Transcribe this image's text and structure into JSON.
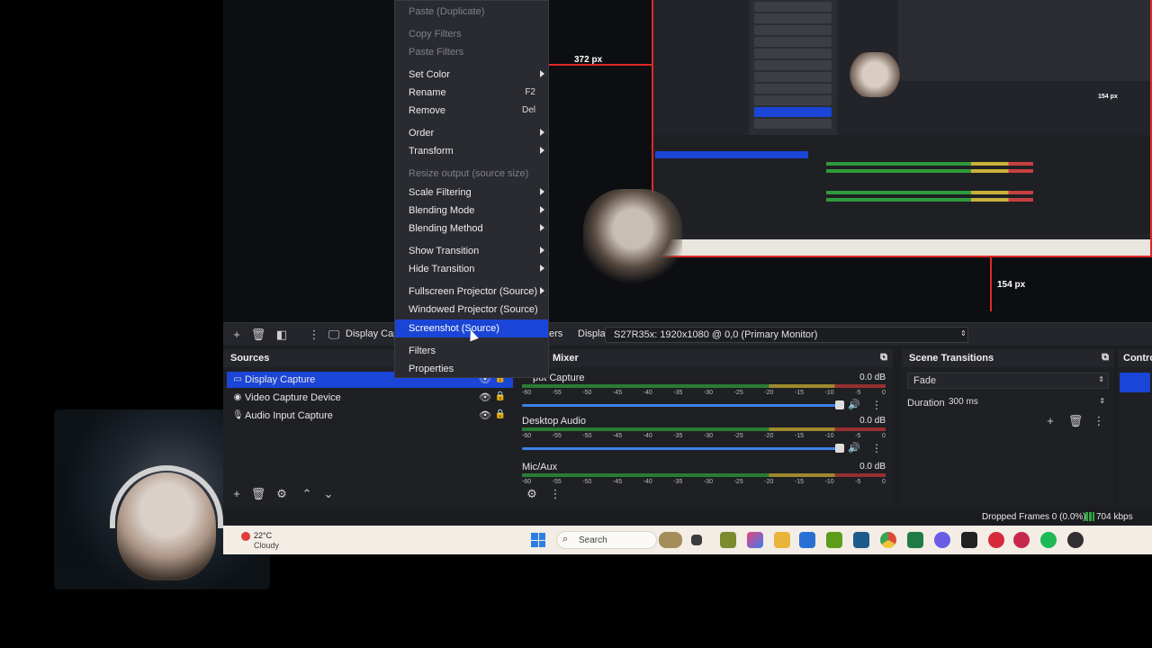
{
  "preview": {
    "width_label": "372 px",
    "height_label": "154 px",
    "mini_height_label": "154 px"
  },
  "toolbar": {
    "source_name": "Display Capt",
    "filters_fragment": "ers",
    "display_label": "Display",
    "display_value": "S27R35x: 1920x1080 @ 0,0 (Primary Monitor)"
  },
  "sources": {
    "title": "Sources",
    "items": [
      {
        "label": "Display Capture",
        "icon": "monitor-icon",
        "selected": true
      },
      {
        "label": "Video Capture Device",
        "icon": "camera-icon",
        "selected": false
      },
      {
        "label": "Audio Input Capture",
        "icon": "microphone-icon",
        "selected": false
      }
    ]
  },
  "mixer": {
    "title": "Mixer",
    "ticks": [
      "-60",
      "-55",
      "-50",
      "-45",
      "-40",
      "-35",
      "-30",
      "-25",
      "-20",
      "-15",
      "-10",
      "-5",
      "0"
    ],
    "channels": [
      {
        "name": "Audio Input Capture",
        "visible_name": "put Capture",
        "db": "0.0 dB",
        "volume": 0.88
      },
      {
        "name": "Desktop Audio",
        "db": "0.0 dB",
        "volume": 0.88
      },
      {
        "name": "Mic/Aux",
        "db": "0.0 dB",
        "volume": null
      }
    ]
  },
  "transitions": {
    "title": "Scene Transitions",
    "selected": "Fade",
    "duration_label": "Duration",
    "duration_value": "300 ms"
  },
  "controls": {
    "title": "Contro"
  },
  "status": {
    "dropped": "Dropped Frames 0 (0.0%)",
    "kbps": "704 kbps"
  },
  "taskbar": {
    "temp": "22°C",
    "condition": "Cloudy",
    "search": "Search"
  },
  "context_menu": {
    "items": [
      {
        "label": "Paste (Duplicate)",
        "disabled": true
      },
      {
        "label": "Copy Filters",
        "disabled": true
      },
      {
        "label": "Paste Filters",
        "disabled": true
      },
      {
        "label": "Set Color",
        "submenu": true
      },
      {
        "label": "Rename",
        "shortcut": "F2"
      },
      {
        "label": "Remove",
        "shortcut": "Del"
      },
      {
        "label": "Order",
        "submenu": true
      },
      {
        "label": "Transform",
        "submenu": true
      },
      {
        "label": "Resize output (source size)",
        "disabled": true
      },
      {
        "label": "Scale Filtering",
        "submenu": true
      },
      {
        "label": "Blending Mode",
        "submenu": true
      },
      {
        "label": "Blending Method",
        "submenu": true
      },
      {
        "label": "Show Transition",
        "submenu": true
      },
      {
        "label": "Hide Transition",
        "submenu": true
      },
      {
        "label": "Fullscreen Projector (Source)",
        "submenu": true
      },
      {
        "label": "Windowed Projector (Source)"
      },
      {
        "label": "Screenshot (Source)",
        "highlighted": true
      },
      {
        "label": "Filters"
      },
      {
        "label": "Properties"
      }
    ]
  },
  "colors": {
    "accent": "#1a45d6",
    "guide_red": "#e02828",
    "background": "#1d1e22"
  }
}
